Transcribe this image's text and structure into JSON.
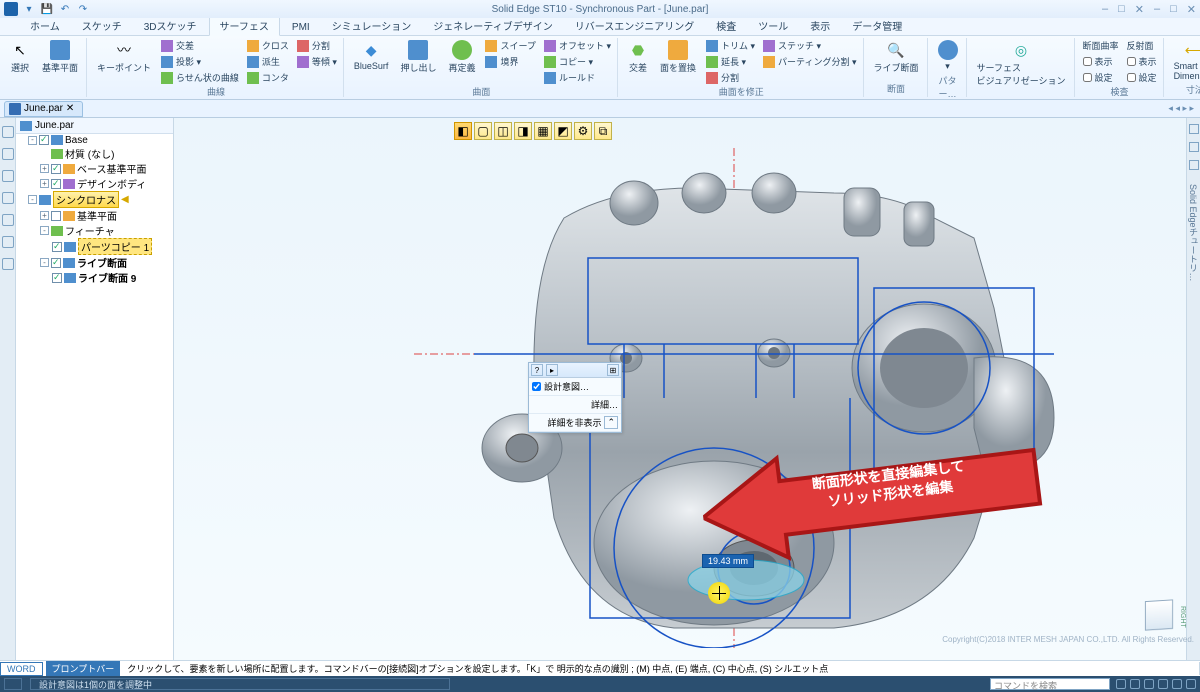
{
  "title": "Solid Edge ST10 - Synchronous Part - [June.par]",
  "qat": {
    "dropdown": "▾",
    "save": "💾",
    "undo": "↶",
    "redo": "↷"
  },
  "wincontrols": {
    "min": "–",
    "max": "□",
    "close": "✕",
    "min2": "–",
    "max2": "□",
    "close2": "✕"
  },
  "tabs": [
    "ホーム",
    "スケッチ",
    "3Dスケッチ",
    "サーフェス",
    "PMI",
    "シミュレーション",
    "ジェネレーティブデザイン",
    "リバースエンジニアリング",
    "検査",
    "ツール",
    "表示",
    "データ管理"
  ],
  "active_tab": 3,
  "ribbon": {
    "g0": {
      "btn0": "選択",
      "btn1": "基準平面",
      "label": ""
    },
    "g1": {
      "btn0": "キーポイント",
      "r0": "交差",
      "r1": "投影 ▾",
      "r2": "らせん状の曲線",
      "r3": "派生",
      "r4": "コンタ",
      "r5": "等傾 ▾",
      "r6": "クロス",
      "r7": "分割",
      "label": "曲線"
    },
    "g2": {
      "btn0": "BlueSurf",
      "btn1": "押し出し",
      "btn2": "再定義",
      "r0": "スイープ",
      "r1": "境界",
      "r2": "オフセット ▾",
      "r3": "コピー ▾",
      "r4": "ルールド",
      "label": "曲面"
    },
    "g3": {
      "btn0": "交差",
      "btn1": "面を置換",
      "r0": "トリム ▾",
      "r1": "延長 ▾",
      "r2": "分割",
      "r3": "ステッチ ▾",
      "r4": "パーティング分割 ▾",
      "label": "曲面を修正"
    },
    "g4": {
      "btn0": "ライブ断面",
      "label": "断面"
    },
    "g5": {
      "btn0": "▾",
      "label": "パター…"
    },
    "g6": {
      "btn0": "サーフェス\nビジュアリゼーション",
      "label": ""
    },
    "g7": {
      "r0": "断面曲率",
      "r1": "表示",
      "r2": "設定",
      "c0": "反射面",
      "c1": "表示",
      "c2": "設定",
      "label": "検査"
    },
    "g8": {
      "btn0": "Smart\nDimension",
      "label": "寸法"
    }
  },
  "doctab": {
    "name": "June.par",
    "close": "✕",
    "nav": "◂ ◂ ▸ ▸"
  },
  "tree": {
    "root": "June.par",
    "n0": "Base",
    "n1": "材質 (なし)",
    "n2": "ベース基準平面",
    "n3": "デザインボディ",
    "n4": "シンクロナス",
    "n5": "基準平面",
    "n6": "フィーチャ",
    "n7": "パーツコピー 1",
    "n8": "ライブ断面",
    "n9": "ライブ断面 9"
  },
  "floatpanel": {
    "help": "?",
    "play": "▸",
    "pin": "⊞",
    "row0": "設計意図…",
    "row1": "詳細…",
    "row2": "詳細を非表示",
    "row2s": "⌃"
  },
  "dimension": "19.43 mm",
  "callout": {
    "l1": "断面形状を直接編集して",
    "l2": "ソリッド形状を編集"
  },
  "viewcube": "RIGHT",
  "righttab": "Solid Edgeチュートリ…",
  "promptbar": {
    "word": "WORD",
    "label": "プロンプトバー",
    "msg": "クリックして、要素を新しい場所に配置します。コマンドバーの[接続図]オプションを設定します。「K」で 明示的な点の識別 ; (M) 中点, (E) 端点, (C) 中心点, (S) シルエット点"
  },
  "copyright": "Copyright(C)2018 INTER MESH JAPAN CO.,LTD. All Rights Reserved.",
  "statusbar": {
    "msg": "設計意図は1個の面を調整中",
    "search": "コマンドを検索"
  }
}
